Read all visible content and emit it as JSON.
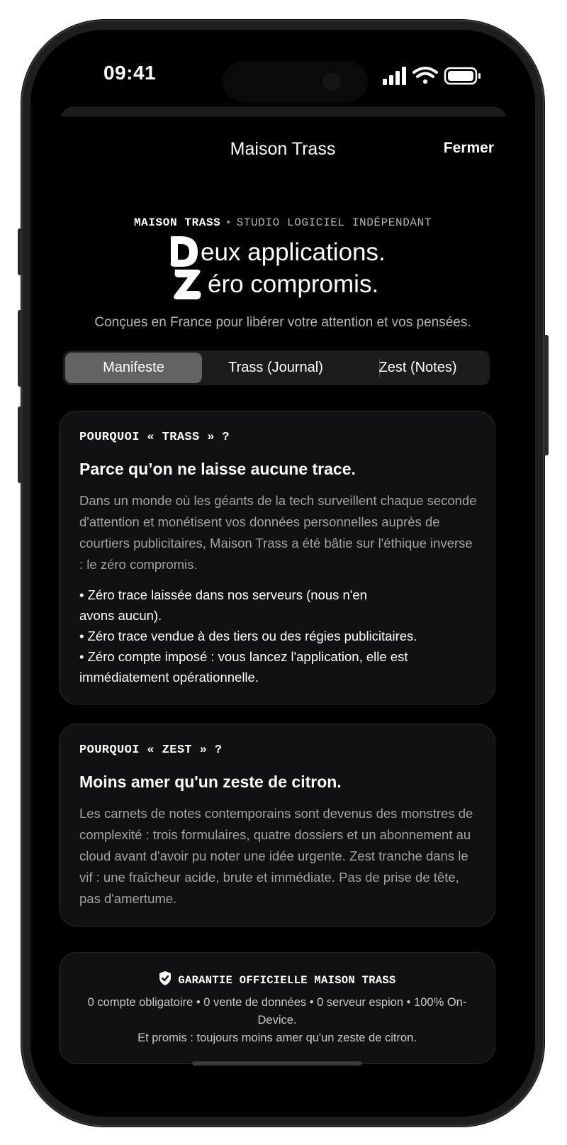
{
  "status": {
    "time": "09:41"
  },
  "nav": {
    "title": "Maison Trass",
    "close_label": "Fermer"
  },
  "header": {
    "brand": "MAISON TRASS",
    "separator": "•",
    "subtitle": "STUDIO LOGICIEL INDÉPENDANT",
    "hero_line1": "eux applications.",
    "hero_line2": "éro compromis.",
    "logo_letters": "DZ",
    "tagline": "Conçues en France pour libérer votre attention et vos pensées."
  },
  "tabs": [
    {
      "label": "Manifeste",
      "active": true
    },
    {
      "label": "Trass (Journal)",
      "active": false
    },
    {
      "label": "Zest (Notes)",
      "active": false
    }
  ],
  "card_trass": {
    "eyebrow": "POURQUOI « TRASS » ?",
    "title": "Parce qu’on ne laisse aucune trace.",
    "body": "Dans un monde où les géants de la tech surveillent chaque seconde d'attention et monétisent vos données personnelles auprès de courtiers publicitaires, Maison Trass a été bâtie sur l'éthique inverse : le zéro compromis.",
    "bullets": [
      "• Zéro trace laissée dans nos serveurs (nous n'en avons aucun).",
      "• Zéro trace vendue à des tiers ou des régies publicitaires.",
      "• Zéro compte imposé : vous lancez l'application, elle est immédiatement opérationnelle."
    ]
  },
  "card_zest": {
    "eyebrow": "POURQUOI « ZEST » ?",
    "title": "Moins amer qu'un zeste de citron.",
    "body": "Les carnets de notes contemporains sont devenus des monstres de complexité : trois formulaires, quatre dossiers et un abonnement au cloud avant d'avoir pu noter une idée urgente. Zest tranche dans le vif : une fraîcheur acide, brute et immédiate. Pas de prise de tête, pas d'amertume."
  },
  "guarantee": {
    "title": "GARANTIE OFFICIELLE MAISON TRASS",
    "line1": "0 compte obligatoire • 0 vente de données • 0 serveur espion • 100% On-Device.",
    "line2": "Et promis : toujours moins amer qu'un zeste de citron."
  }
}
